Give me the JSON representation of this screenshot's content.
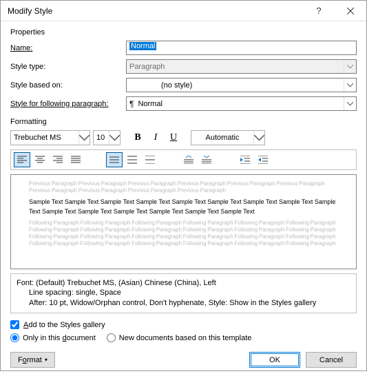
{
  "title": "Modify Style",
  "group_properties": "Properties",
  "group_formatting": "Formatting",
  "labels": {
    "name": "Name:",
    "style_type": "Style type:",
    "style_based_on": "Style based on:",
    "style_following": "Style for following paragraph:"
  },
  "fields": {
    "name_value": "Normal",
    "style_type": "Paragraph",
    "style_based_on": "(no style)",
    "style_following": "Normal"
  },
  "font": {
    "name": "Trebuchet MS",
    "size": "10",
    "bold": "B",
    "italic": "I",
    "underline": "U",
    "color": "Automatic"
  },
  "preview": {
    "previous": "Previous Paragraph Previous Paragraph Previous Paragraph Previous Paragraph Previous Paragraph Previous Paragraph Previous Paragraph Previous Paragraph Previous Paragraph Previous Paragraph",
    "sample": "Sample Text Sample Text Sample Text Sample Text Sample Text Sample Text Sample Text Sample Text Sample Text Sample Text Sample Text Sample Text Sample Text Sample Text Sample Text",
    "following": "Following Paragraph Following Paragraph Following Paragraph Following Paragraph Following Paragraph Following Paragraph Following Paragraph Following Paragraph Following Paragraph Following Paragraph Following Paragraph Following Paragraph Following Paragraph Following Paragraph Following Paragraph Following Paragraph Following Paragraph Following Paragraph Following Paragraph Following Paragraph Following Paragraph Following Paragraph Following Paragraph Following Paragraph"
  },
  "description": {
    "line1": "Font: (Default) Trebuchet MS, (Asian) Chinese (China), Left",
    "line2": "Line spacing:  single, Space",
    "line3": "After:  10 pt, Widow/Orphan control, Don't hyphenate, Style: Show in the Styles gallery"
  },
  "checks": {
    "add_gallery": "Add to the Styles gallery",
    "only_doc": "Only in this document",
    "new_docs": "New documents based on this template"
  },
  "buttons": {
    "format": "Format",
    "ok": "OK",
    "cancel": "Cancel"
  }
}
